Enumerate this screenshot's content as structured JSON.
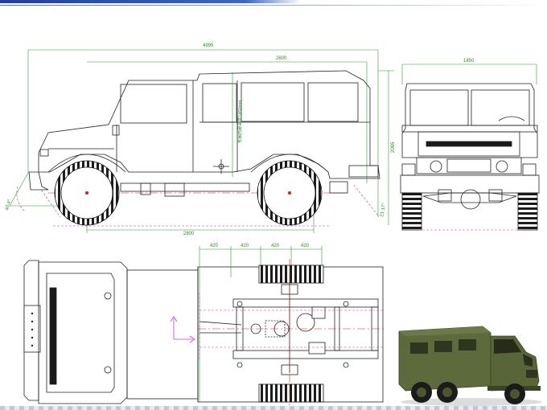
{
  "slide": {
    "dimensions": {
      "side_overall_length": "4995",
      "side_wheelbase_top": "2600",
      "side_body_height": "2065",
      "side_wheelbase_bottom": "2800",
      "side_approach_angle": "40.4°",
      "side_departure_angle": "21.17°",
      "side_vertical_label": "车厢内部高度1450mm",
      "front_width": "1850",
      "plan_spacing_1": "420",
      "plan_spacing_2": "420",
      "plan_spacing_3": "420",
      "plan_spacing_4": "420"
    },
    "photo": {
      "body_color": "#5d6a3b",
      "dark_color": "#3b4426"
    },
    "colors": {
      "dimension_line": "#2f9b2f",
      "centerline": "#d02020",
      "hidden_line": "#b040b0",
      "drawing_line": "#222222"
    }
  }
}
